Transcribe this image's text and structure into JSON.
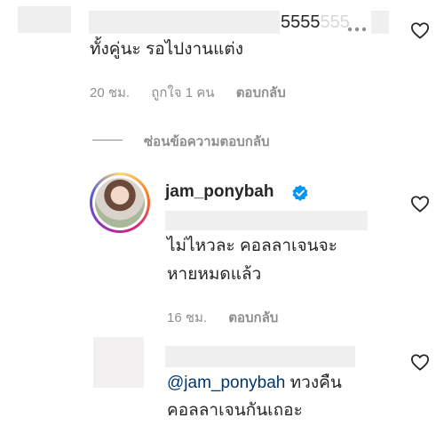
{
  "comment1": {
    "header_text": "5555",
    "header_faded": "555",
    "more_icon": "more-horizontal-icon",
    "text": "ทั้งคู่นะ รอไปงานแต่ง",
    "time": "20 ชม.",
    "likes": "ถูกใจ 1 คน",
    "reply": "ตอบกลับ"
  },
  "hide_replies": {
    "label": "ซ่อนข้อความตอบกลับ"
  },
  "reply1": {
    "username": "jam_ponybah",
    "verified_icon": "verified-badge-icon",
    "text_line1": "ไม่ไหวละ คอลลาเจนจะ",
    "text_line2": "หายหมดแล้ว",
    "time": "16 ชม.",
    "reply": "ตอบกลับ"
  },
  "reply2": {
    "mention": "@jam_ponybah",
    "text_after_mention": " ทวงคืน",
    "text_line2": "คอลลาเจนกันเถอะ"
  },
  "icons": {
    "like": "heart-outline-icon"
  },
  "colors": {
    "text": "#262626",
    "meta": "#8e8e8e",
    "mention": "#00376b",
    "verified": "#0095f6"
  }
}
